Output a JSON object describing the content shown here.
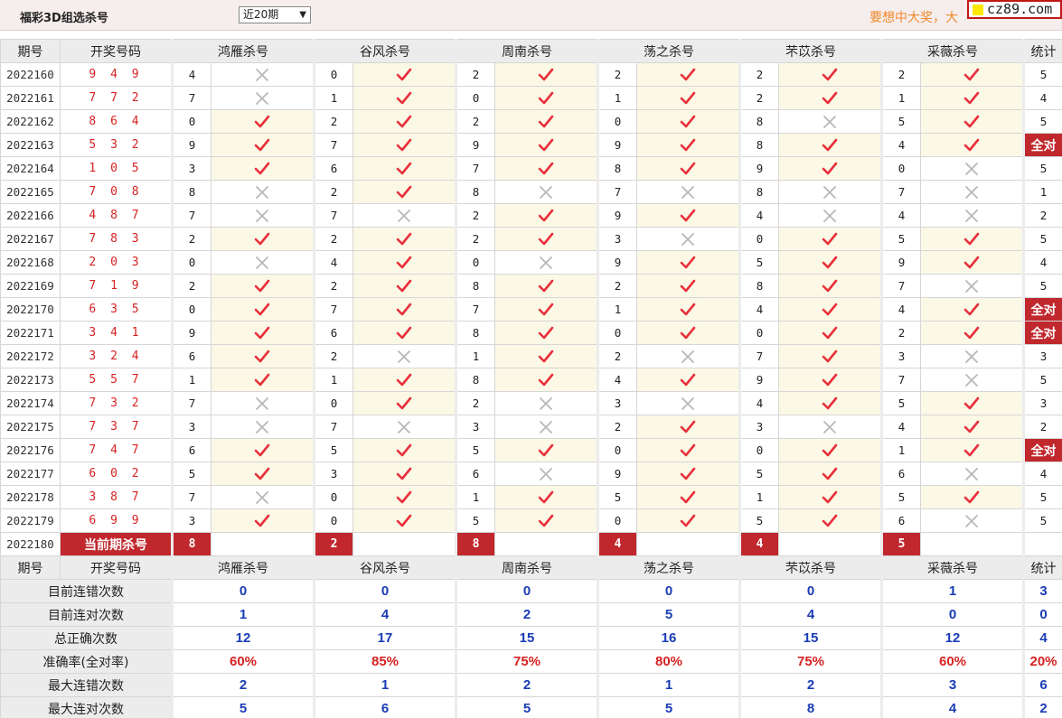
{
  "header": {
    "title": "福彩3D组选杀号",
    "period_select": "近20期",
    "slogan": "要想中大奖，大",
    "site_badge": "cz89.com"
  },
  "columns": {
    "period": "期号",
    "draw": "开奖号码",
    "experts": [
      "鸿雁杀号",
      "谷风杀号",
      "周南杀号",
      "荡之杀号",
      "芣苡杀号",
      "采薇杀号"
    ],
    "stat": "统计"
  },
  "rows": [
    {
      "period": "2022160",
      "draw": "9 4 9",
      "picks": [
        [
          "4",
          "x"
        ],
        [
          "0",
          "v"
        ],
        [
          "2",
          "v"
        ],
        [
          "2",
          "v"
        ],
        [
          "2",
          "v"
        ],
        [
          "2",
          "v"
        ]
      ],
      "stat": "5"
    },
    {
      "period": "2022161",
      "draw": "7 7 2",
      "picks": [
        [
          "7",
          "x"
        ],
        [
          "1",
          "v"
        ],
        [
          "0",
          "v"
        ],
        [
          "1",
          "v"
        ],
        [
          "2",
          "v"
        ],
        [
          "1",
          "v"
        ]
      ],
      "stat": "4"
    },
    {
      "period": "2022162",
      "draw": "8 6 4",
      "picks": [
        [
          "0",
          "v"
        ],
        [
          "2",
          "v"
        ],
        [
          "2",
          "v"
        ],
        [
          "0",
          "v"
        ],
        [
          "8",
          "x"
        ],
        [
          "5",
          "v"
        ]
      ],
      "stat": "5"
    },
    {
      "period": "2022163",
      "draw": "5 3 2",
      "picks": [
        [
          "9",
          "v"
        ],
        [
          "7",
          "v"
        ],
        [
          "9",
          "v"
        ],
        [
          "9",
          "v"
        ],
        [
          "8",
          "v"
        ],
        [
          "4",
          "v"
        ]
      ],
      "stat": "全对"
    },
    {
      "period": "2022164",
      "draw": "1 0 5",
      "picks": [
        [
          "3",
          "v"
        ],
        [
          "6",
          "v"
        ],
        [
          "7",
          "v"
        ],
        [
          "8",
          "v"
        ],
        [
          "9",
          "v"
        ],
        [
          "0",
          "x"
        ]
      ],
      "stat": "5"
    },
    {
      "period": "2022165",
      "draw": "7 0 8",
      "picks": [
        [
          "8",
          "x"
        ],
        [
          "2",
          "v"
        ],
        [
          "8",
          "x"
        ],
        [
          "7",
          "x"
        ],
        [
          "8",
          "x"
        ],
        [
          "7",
          "x"
        ]
      ],
      "stat": "1"
    },
    {
      "period": "2022166",
      "draw": "4 8 7",
      "picks": [
        [
          "7",
          "x"
        ],
        [
          "7",
          "x"
        ],
        [
          "2",
          "v"
        ],
        [
          "9",
          "v"
        ],
        [
          "4",
          "x"
        ],
        [
          "4",
          "x"
        ]
      ],
      "stat": "2"
    },
    {
      "period": "2022167",
      "draw": "7 8 3",
      "picks": [
        [
          "2",
          "v"
        ],
        [
          "2",
          "v"
        ],
        [
          "2",
          "v"
        ],
        [
          "3",
          "x"
        ],
        [
          "0",
          "v"
        ],
        [
          "5",
          "v"
        ]
      ],
      "stat": "5"
    },
    {
      "period": "2022168",
      "draw": "2 0 3",
      "picks": [
        [
          "0",
          "x"
        ],
        [
          "4",
          "v"
        ],
        [
          "0",
          "x"
        ],
        [
          "9",
          "v"
        ],
        [
          "5",
          "v"
        ],
        [
          "9",
          "v"
        ]
      ],
      "stat": "4"
    },
    {
      "period": "2022169",
      "draw": "7 1 9",
      "picks": [
        [
          "2",
          "v"
        ],
        [
          "2",
          "v"
        ],
        [
          "8",
          "v"
        ],
        [
          "2",
          "v"
        ],
        [
          "8",
          "v"
        ],
        [
          "7",
          "x"
        ]
      ],
      "stat": "5"
    },
    {
      "period": "2022170",
      "draw": "6 3 5",
      "picks": [
        [
          "0",
          "v"
        ],
        [
          "7",
          "v"
        ],
        [
          "7",
          "v"
        ],
        [
          "1",
          "v"
        ],
        [
          "4",
          "v"
        ],
        [
          "4",
          "v"
        ]
      ],
      "stat": "全对"
    },
    {
      "period": "2022171",
      "draw": "3 4 1",
      "picks": [
        [
          "9",
          "v"
        ],
        [
          "6",
          "v"
        ],
        [
          "8",
          "v"
        ],
        [
          "0",
          "v"
        ],
        [
          "0",
          "v"
        ],
        [
          "2",
          "v"
        ]
      ],
      "stat": "全对"
    },
    {
      "period": "2022172",
      "draw": "3 2 4",
      "picks": [
        [
          "6",
          "v"
        ],
        [
          "2",
          "x"
        ],
        [
          "1",
          "v"
        ],
        [
          "2",
          "x"
        ],
        [
          "7",
          "v"
        ],
        [
          "3",
          "x"
        ]
      ],
      "stat": "3"
    },
    {
      "period": "2022173",
      "draw": "5 5 7",
      "picks": [
        [
          "1",
          "v"
        ],
        [
          "1",
          "v"
        ],
        [
          "8",
          "v"
        ],
        [
          "4",
          "v"
        ],
        [
          "9",
          "v"
        ],
        [
          "7",
          "x"
        ]
      ],
      "stat": "5"
    },
    {
      "period": "2022174",
      "draw": "7 3 2",
      "picks": [
        [
          "7",
          "x"
        ],
        [
          "0",
          "v"
        ],
        [
          "2",
          "x"
        ],
        [
          "3",
          "x"
        ],
        [
          "4",
          "v"
        ],
        [
          "5",
          "v"
        ]
      ],
      "stat": "3"
    },
    {
      "period": "2022175",
      "draw": "7 3 7",
      "picks": [
        [
          "3",
          "x"
        ],
        [
          "7",
          "x"
        ],
        [
          "3",
          "x"
        ],
        [
          "2",
          "v"
        ],
        [
          "3",
          "x"
        ],
        [
          "4",
          "v"
        ]
      ],
      "stat": "2"
    },
    {
      "period": "2022176",
      "draw": "7 4 7",
      "picks": [
        [
          "6",
          "v"
        ],
        [
          "5",
          "v"
        ],
        [
          "5",
          "v"
        ],
        [
          "0",
          "v"
        ],
        [
          "0",
          "v"
        ],
        [
          "1",
          "v"
        ]
      ],
      "stat": "全对"
    },
    {
      "period": "2022177",
      "draw": "6 0 2",
      "picks": [
        [
          "5",
          "v"
        ],
        [
          "3",
          "v"
        ],
        [
          "6",
          "x"
        ],
        [
          "9",
          "v"
        ],
        [
          "5",
          "v"
        ],
        [
          "6",
          "x"
        ]
      ],
      "stat": "4"
    },
    {
      "period": "2022178",
      "draw": "3 8 7",
      "picks": [
        [
          "7",
          "x"
        ],
        [
          "0",
          "v"
        ],
        [
          "1",
          "v"
        ],
        [
          "5",
          "v"
        ],
        [
          "1",
          "v"
        ],
        [
          "5",
          "v"
        ]
      ],
      "stat": "5"
    },
    {
      "period": "2022179",
      "draw": "6 9 9",
      "picks": [
        [
          "3",
          "v"
        ],
        [
          "0",
          "v"
        ],
        [
          "5",
          "v"
        ],
        [
          "0",
          "v"
        ],
        [
          "5",
          "v"
        ],
        [
          "6",
          "x"
        ]
      ],
      "stat": "5"
    }
  ],
  "current": {
    "period": "2022180",
    "label": "当前期杀号",
    "picks": [
      "8",
      "2",
      "8",
      "4",
      "4",
      "5"
    ]
  },
  "summary": {
    "rows": [
      {
        "label": "目前连错次数",
        "values": [
          "0",
          "0",
          "0",
          "0",
          "0",
          "1"
        ],
        "stat": "3",
        "red": false
      },
      {
        "label": "目前连对次数",
        "values": [
          "1",
          "4",
          "2",
          "5",
          "4",
          "0"
        ],
        "stat": "0",
        "red": false
      },
      {
        "label": "总正确次数",
        "values": [
          "12",
          "17",
          "15",
          "16",
          "15",
          "12"
        ],
        "stat": "4",
        "red": false
      },
      {
        "label": "准确率(全对率)",
        "values": [
          "60%",
          "85%",
          "75%",
          "80%",
          "75%",
          "60%"
        ],
        "stat": "20%",
        "red": true
      },
      {
        "label": "最大连错次数",
        "values": [
          "2",
          "1",
          "2",
          "1",
          "2",
          "3"
        ],
        "stat": "6",
        "red": false
      },
      {
        "label": "最大连对次数",
        "values": [
          "5",
          "6",
          "5",
          "5",
          "8",
          "4"
        ],
        "stat": "2",
        "red": false
      }
    ]
  },
  "colors": {
    "hit_mark": "#e8303a",
    "miss_mark": "#b8b8b8",
    "accent_red": "#c0282d",
    "value_blue": "#1a3cb5"
  },
  "icons": {
    "hit": "check-icon",
    "miss": "cross-icon"
  }
}
